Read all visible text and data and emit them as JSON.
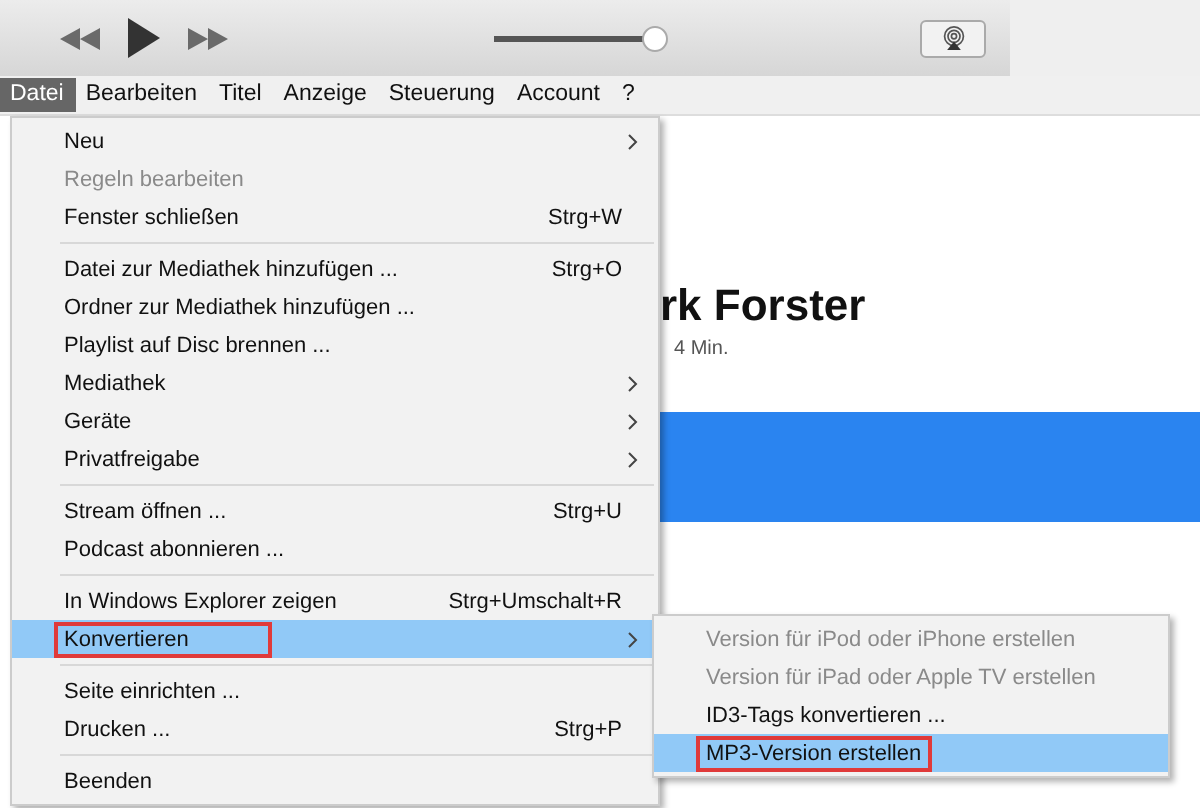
{
  "toolbar": {
    "volume": {
      "level": 0.93
    }
  },
  "menubar": [
    {
      "label": "Datei",
      "selected": true
    },
    {
      "label": "Bearbeiten",
      "selected": false
    },
    {
      "label": "Titel",
      "selected": false
    },
    {
      "label": "Anzeige",
      "selected": false
    },
    {
      "label": "Steuerung",
      "selected": false
    },
    {
      "label": "Account",
      "selected": false
    },
    {
      "label": "?",
      "selected": false
    }
  ],
  "content": {
    "title": "rk Forster",
    "subtitle": "4 Min."
  },
  "menu": [
    {
      "kind": "item",
      "label": "Neu",
      "submenu": true,
      "disabled": false,
      "selected": false,
      "highlighted": false
    },
    {
      "kind": "item",
      "label": "Regeln bearbeiten",
      "submenu": false,
      "disabled": true,
      "selected": false,
      "highlighted": false
    },
    {
      "kind": "item",
      "label": "Fenster schließen",
      "shortcut": "Strg+W",
      "submenu": false,
      "disabled": false,
      "selected": false,
      "highlighted": false
    },
    {
      "kind": "separator"
    },
    {
      "kind": "item",
      "label": "Datei zur Mediathek hinzufügen ...",
      "shortcut": "Strg+O",
      "submenu": false,
      "disabled": false,
      "selected": false,
      "highlighted": false
    },
    {
      "kind": "item",
      "label": "Ordner zur Mediathek hinzufügen ...",
      "submenu": false,
      "disabled": false,
      "selected": false,
      "highlighted": false
    },
    {
      "kind": "item",
      "label": "Playlist auf Disc brennen ...",
      "submenu": false,
      "disabled": false,
      "selected": false,
      "highlighted": false
    },
    {
      "kind": "item",
      "label": "Mediathek",
      "submenu": true,
      "disabled": false,
      "selected": false,
      "highlighted": false
    },
    {
      "kind": "item",
      "label": "Geräte",
      "submenu": true,
      "disabled": false,
      "selected": false,
      "highlighted": false
    },
    {
      "kind": "item",
      "label": "Privatfreigabe",
      "submenu": true,
      "disabled": false,
      "selected": false,
      "highlighted": false
    },
    {
      "kind": "separator"
    },
    {
      "kind": "item",
      "label": "Stream öffnen ...",
      "shortcut": "Strg+U",
      "submenu": false,
      "disabled": false,
      "selected": false,
      "highlighted": false
    },
    {
      "kind": "item",
      "label": "Podcast abonnieren ...",
      "submenu": false,
      "disabled": false,
      "selected": false,
      "highlighted": false
    },
    {
      "kind": "separator"
    },
    {
      "kind": "item",
      "label": "In Windows Explorer zeigen",
      "shortcut": "Strg+Umschalt+R",
      "submenu": false,
      "disabled": false,
      "selected": false,
      "highlighted": false
    },
    {
      "kind": "item",
      "label": "Konvertieren",
      "submenu": true,
      "disabled": false,
      "selected": true,
      "highlighted": true
    },
    {
      "kind": "separator"
    },
    {
      "kind": "item",
      "label": "Seite einrichten ...",
      "submenu": false,
      "disabled": false,
      "selected": false,
      "highlighted": false
    },
    {
      "kind": "item",
      "label": "Drucken ...",
      "shortcut": "Strg+P",
      "submenu": false,
      "disabled": false,
      "selected": false,
      "highlighted": false
    },
    {
      "kind": "separator"
    },
    {
      "kind": "item",
      "label": "Beenden",
      "submenu": false,
      "disabled": false,
      "selected": false,
      "highlighted": false
    }
  ],
  "submenu": [
    {
      "label": "Version für iPod oder iPhone erstellen",
      "disabled": true,
      "selected": false,
      "highlighted": false
    },
    {
      "label": "Version für iPad oder Apple TV erstellen",
      "disabled": true,
      "selected": false,
      "highlighted": false
    },
    {
      "label": "ID3-Tags konvertieren ...",
      "disabled": false,
      "selected": false,
      "highlighted": false
    },
    {
      "label": "MP3-Version erstellen",
      "disabled": false,
      "selected": true,
      "highlighted": true
    }
  ]
}
